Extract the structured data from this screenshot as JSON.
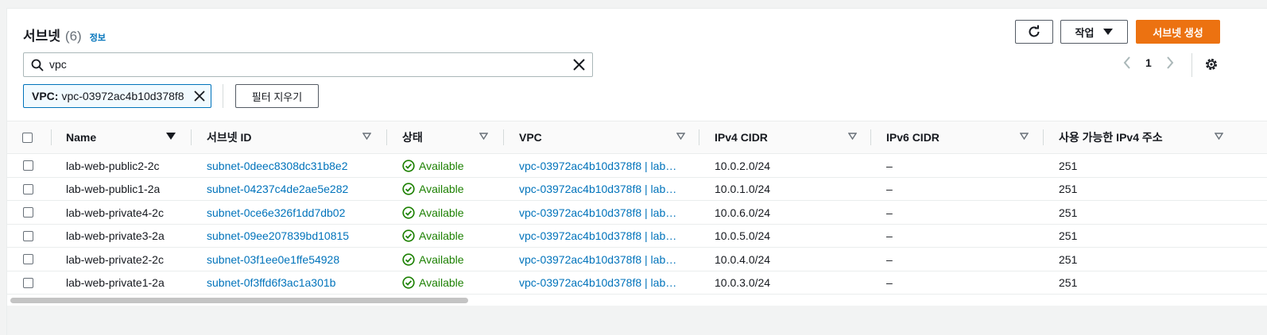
{
  "header": {
    "title": "서브넷",
    "count": "(6)",
    "info_link": "정보"
  },
  "toolbar": {
    "actions_label": "작업",
    "create_label": "서브넷 생성",
    "icons": {
      "refresh": "refresh-icon",
      "settings": "gear-icon"
    }
  },
  "search": {
    "value": "vpc"
  },
  "pagination": {
    "current_page": "1"
  },
  "filter_token": {
    "key": "VPC:",
    "value": "vpc-03972ac4b10d378f8"
  },
  "clear_filter_label": "필터 지우기",
  "table": {
    "columns": [
      "Name",
      "서브넷 ID",
      "상태",
      "VPC",
      "IPv4 CIDR",
      "IPv6 CIDR",
      "사용 가능한 IPv4 주소"
    ],
    "rows": [
      {
        "name": "lab-web-public2-2c",
        "subnet_id": "subnet-0deec8308dc31b8e2",
        "status": "Available",
        "vpc": "vpc-03972ac4b10d378f8 | lab…",
        "ipv4": "10.0.2.0/24",
        "ipv6": "–",
        "available_ipv4": "251"
      },
      {
        "name": "lab-web-public1-2a",
        "subnet_id": "subnet-04237c4de2ae5e282",
        "status": "Available",
        "vpc": "vpc-03972ac4b10d378f8 | lab…",
        "ipv4": "10.0.1.0/24",
        "ipv6": "–",
        "available_ipv4": "251"
      },
      {
        "name": "lab-web-private4-2c",
        "subnet_id": "subnet-0ce6e326f1dd7db02",
        "status": "Available",
        "vpc": "vpc-03972ac4b10d378f8 | lab…",
        "ipv4": "10.0.6.0/24",
        "ipv6": "–",
        "available_ipv4": "251"
      },
      {
        "name": "lab-web-private3-2a",
        "subnet_id": "subnet-09ee207839bd10815",
        "status": "Available",
        "vpc": "vpc-03972ac4b10d378f8 | lab…",
        "ipv4": "10.0.5.0/24",
        "ipv6": "–",
        "available_ipv4": "251"
      },
      {
        "name": "lab-web-private2-2c",
        "subnet_id": "subnet-03f1ee0e1ffe54928",
        "status": "Available",
        "vpc": "vpc-03972ac4b10d378f8 | lab…",
        "ipv4": "10.0.4.0/24",
        "ipv6": "–",
        "available_ipv4": "251"
      },
      {
        "name": "lab-web-private1-2a",
        "subnet_id": "subnet-0f3ffd6f3ac1a301b",
        "status": "Available",
        "vpc": "vpc-03972ac4b10d378f8 | lab…",
        "ipv4": "10.0.3.0/24",
        "ipv6": "–",
        "available_ipv4": "251"
      }
    ]
  },
  "colors": {
    "primary": "#ec7211",
    "link": "#0073bb",
    "success": "#1d8102"
  }
}
